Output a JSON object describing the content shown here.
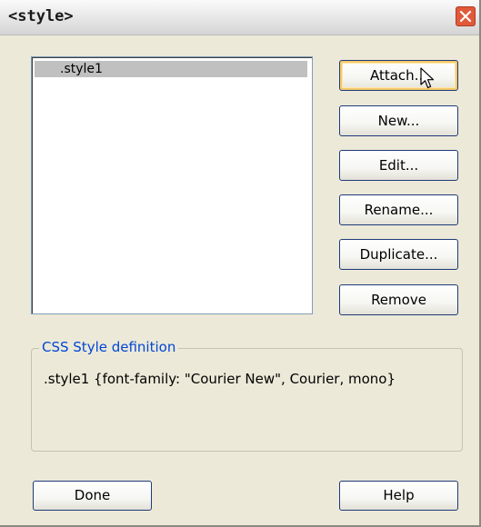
{
  "window": {
    "title": "<style>"
  },
  "styles_list": {
    "items": [
      ".style1"
    ],
    "selected_index": 0
  },
  "buttons": {
    "attach": "Attach...",
    "new": "New...",
    "edit": "Edit...",
    "rename": "Rename...",
    "duplicate": "Duplicate...",
    "remove": "Remove",
    "done": "Done",
    "help": "Help"
  },
  "definition": {
    "legend": "CSS Style definition",
    "text": ".style1 {font-family: \"Courier New\", Courier, mono}"
  },
  "colors": {
    "dialog_bg": "#ece9d8",
    "legend_text": "#0046d5",
    "selected_item_bg": "#c0c0c0",
    "close_button": "#e05a3a"
  }
}
